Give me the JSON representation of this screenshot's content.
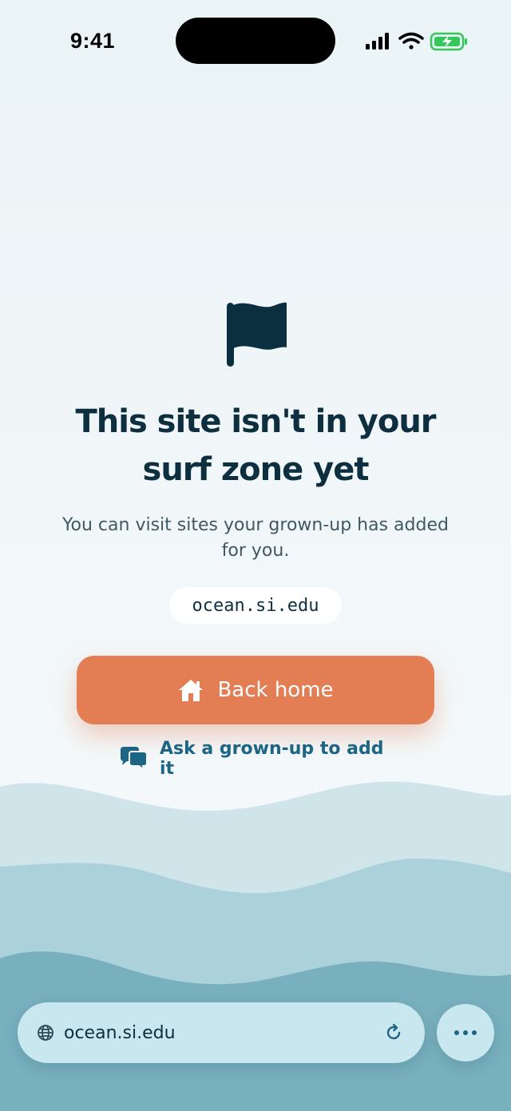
{
  "status_bar": {
    "time": "9:41",
    "icons": [
      "cellular-signal-icon",
      "wifi-icon",
      "battery-charging-icon"
    ],
    "battery_color": "#34c759"
  },
  "block_screen": {
    "icon": "flag-icon",
    "title": "This site isn't in your surf zone yet",
    "subtitle": "You can visit sites your grown-up has added for you.",
    "domain": "ocean.si.edu",
    "primary_button": {
      "icon": "home-icon",
      "label": "Back home"
    },
    "secondary_link": {
      "icon": "chat-bubbles-icon",
      "label": "Ask a grown-up to add it"
    }
  },
  "address_bar": {
    "icon": "globe-icon",
    "url": "ocean.si.edu",
    "reload_icon": "reload-icon",
    "more_icon": "more-dots-icon"
  },
  "colors": {
    "title": "#0d2f40",
    "accent_button": "#e37d53",
    "link": "#1c6585",
    "wave_light": "#d0e5ea",
    "wave_mid": "#a9d0d9",
    "wave_dark": "#78afbd",
    "address_bar": "#c8e7ee"
  }
}
